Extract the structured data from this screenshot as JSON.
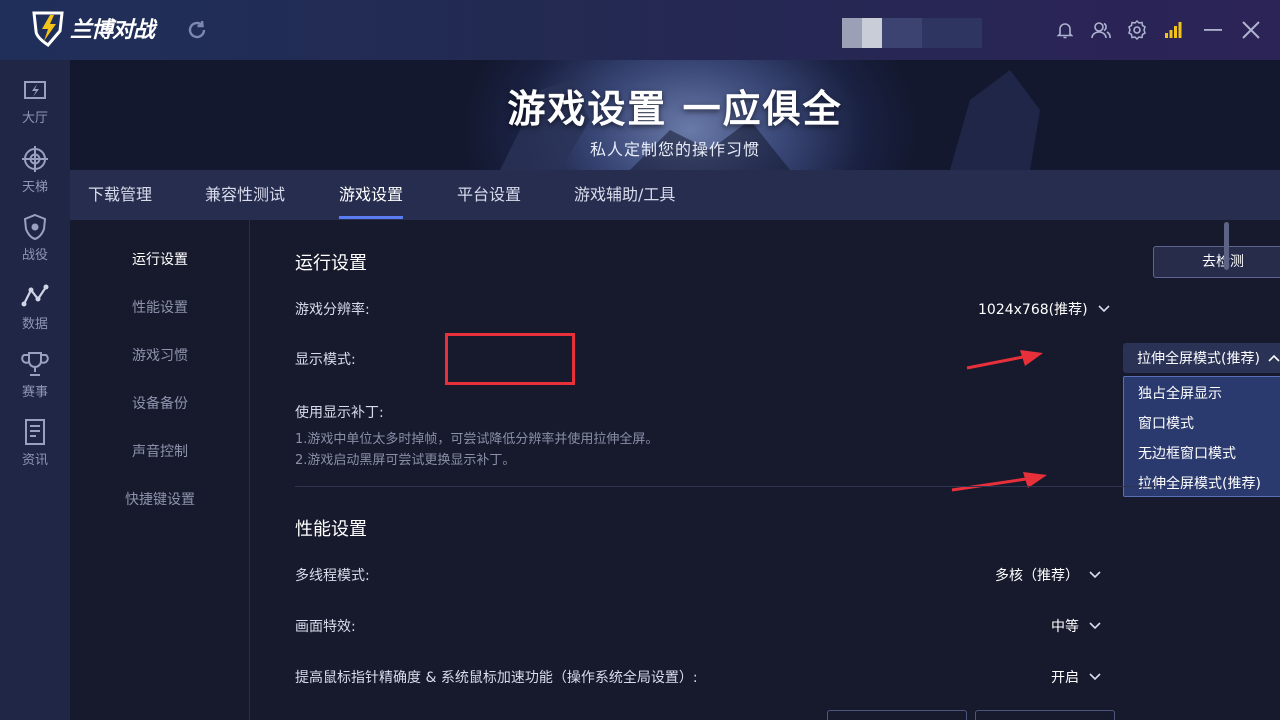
{
  "app": {
    "title": "兰博对战"
  },
  "topbar": {
    "icons": [
      "refresh-icon",
      "bell-icon",
      "friends-icon",
      "gear-icon",
      "signal-icon",
      "minimize-icon",
      "close-icon"
    ],
    "accent": "#f2c318"
  },
  "leftnav": {
    "items": [
      {
        "label": "大厅",
        "icon": "lobby-icon"
      },
      {
        "label": "天梯",
        "icon": "crosshair-icon"
      },
      {
        "label": "战役",
        "icon": "shield-icon"
      },
      {
        "label": "数据",
        "icon": "chart-icon"
      },
      {
        "label": "赛事",
        "icon": "trophy-icon"
      },
      {
        "label": "资讯",
        "icon": "news-icon"
      }
    ]
  },
  "banner": {
    "title": "游戏设置 一应俱全",
    "subtitle": "私人定制您的操作习惯"
  },
  "tabs": [
    {
      "label": "下载管理",
      "active": false
    },
    {
      "label": "兼容性测试",
      "active": false
    },
    {
      "label": "游戏设置",
      "active": true
    },
    {
      "label": "平台设置",
      "active": false
    },
    {
      "label": "游戏辅助/工具",
      "active": false
    }
  ],
  "subnav": {
    "items": [
      {
        "label": "运行设置",
        "active": true
      },
      {
        "label": "性能设置",
        "active": false
      },
      {
        "label": "游戏习惯",
        "active": false
      },
      {
        "label": "设备备份",
        "active": false
      },
      {
        "label": "声音控制",
        "active": false
      },
      {
        "label": "快捷键设置",
        "active": false
      }
    ]
  },
  "run_settings": {
    "title": "运行设置",
    "detect_button": "去检测",
    "resolution_label": "游戏分辨率:",
    "resolution_value": "1024x768(推荐)",
    "display_mode_label": "显示模式:",
    "display_mode_value": "拉伸全屏模式(推荐)",
    "display_mode_options": [
      "独占全屏显示",
      "窗口模式",
      "无边框窗口模式",
      "拉伸全屏模式(推荐)"
    ],
    "patch_label": "使用显示补丁:",
    "hint_1": "1.游戏中单位太多时掉帧，可尝试降低分辨率并使用拉伸全屏。",
    "hint_2": "2.游戏启动黑屏可尝试更换显示补丁。"
  },
  "perf_settings": {
    "title": "性能设置",
    "multithread_label": "多线程模式:",
    "multithread_value": "多核（推荐）",
    "effects_label": "画面特效:",
    "effects_value": "中等",
    "mouse_label": "提高鼠标指针精确度 & 系统鼠标加速功能（操作系统全局设置）:",
    "mouse_value": "开启"
  },
  "colors": {
    "highlight": "#e8303a",
    "tab_underline": "#5a7cf0",
    "dropdown_bg": "#2b3a6e"
  }
}
